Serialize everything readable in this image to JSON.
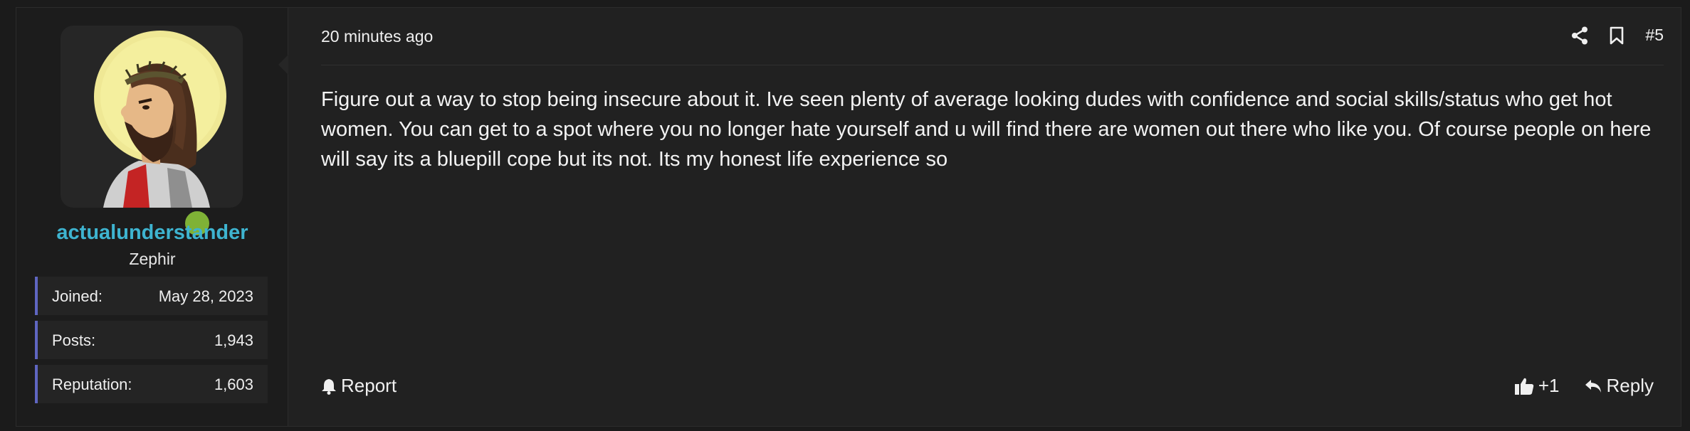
{
  "user": {
    "username": "actualunderstander",
    "title": "Zephir",
    "avatar_icon": "jesus-avatar-icon",
    "online_color": "#7fb236",
    "stats": [
      {
        "label": "Joined:",
        "value": "May 28, 2023"
      },
      {
        "label": "Posts:",
        "value": "1,943"
      },
      {
        "label": "Reputation:",
        "value": "1,603"
      }
    ]
  },
  "post": {
    "timestamp": "20 minutes ago",
    "number": "#5",
    "body": "Figure out a way to stop being insecure about it. Ive seen plenty of average looking dudes with confidence and social skills/status who get hot women. You can get to a spot where you no longer hate yourself and u will find there are women out there who like you. Of course people on here will say its a bluepill cope but its not. Its my honest life experience so"
  },
  "actions": {
    "report": "Report",
    "like": "+1",
    "reply": "Reply"
  },
  "colors": {
    "username": "#3eb4d0",
    "stat_accent": "#5f66c1",
    "background": "#212121"
  }
}
